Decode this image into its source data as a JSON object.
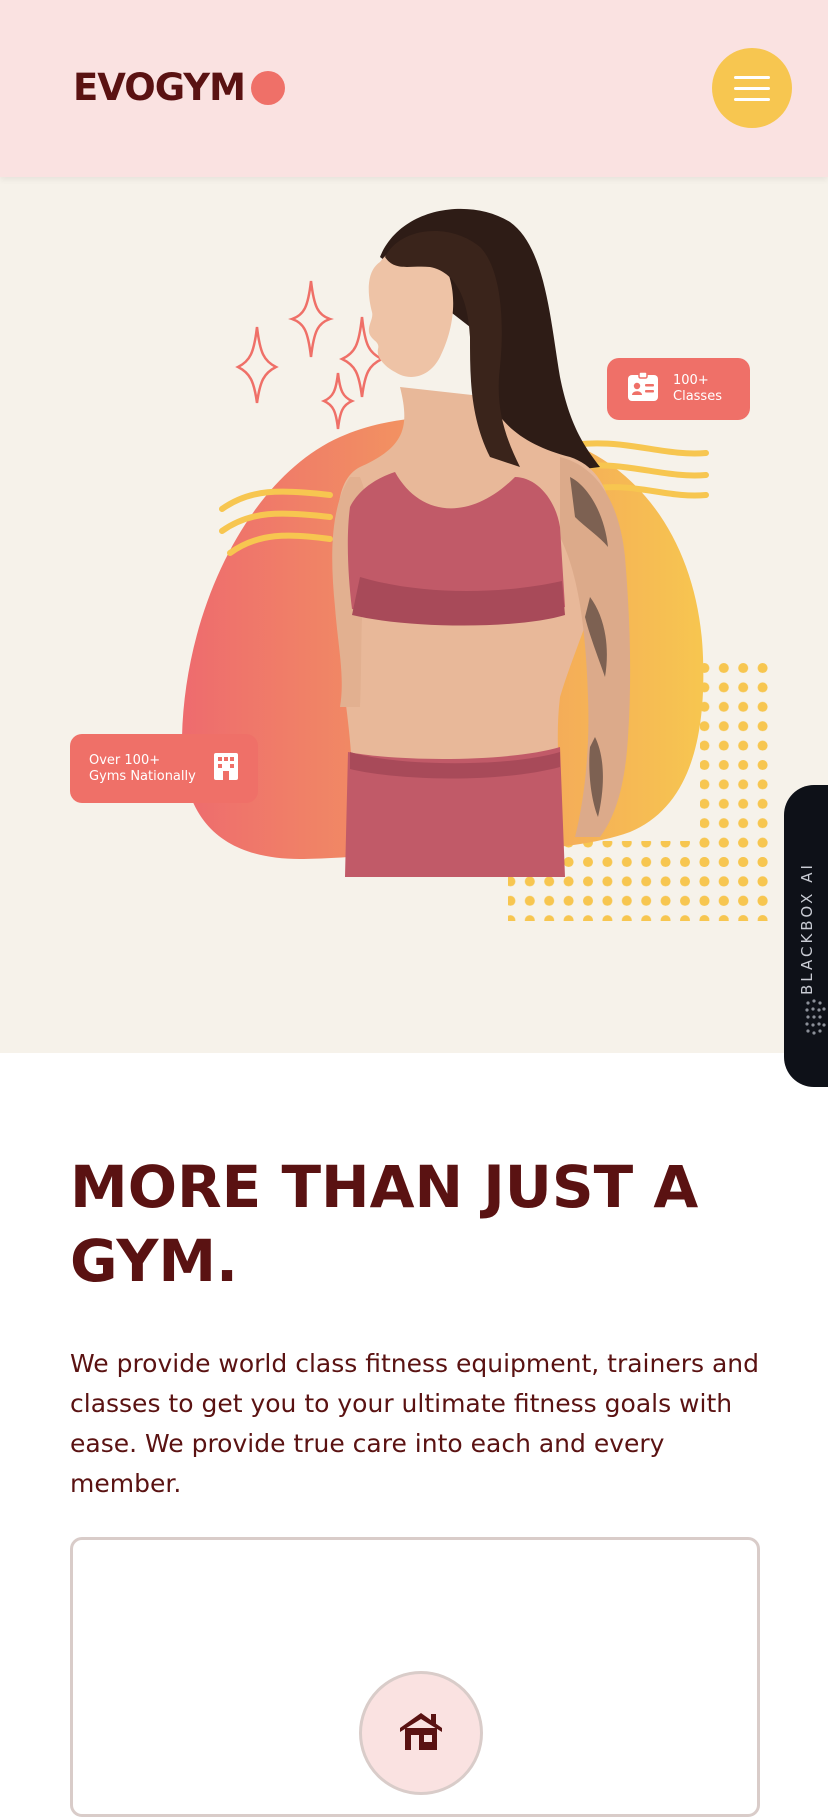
{
  "header": {
    "logo_text": "EVOGYM",
    "menu_icon": "hamburger-menu-icon"
  },
  "hero": {
    "badge_classes": {
      "line1": "100+",
      "line2": "Classes",
      "icon": "id-card-icon"
    },
    "badge_gyms": {
      "line1": "Over 100+",
      "line2": "Gyms Nationally",
      "icon": "building-icon"
    }
  },
  "side_tab": {
    "label": "BLACKBOX AI"
  },
  "main": {
    "title_line1": "MORE THAN JUST A",
    "title_line2": "GYM.",
    "description": "We provide world class fitness equipment, trainers and classes to get you to your ultimate fitness goals with ease. We provide true care into each and every member.",
    "card_icon": "home-icon"
  },
  "colors": {
    "header_bg": "#fae2e1",
    "primary_red": "#ef7068",
    "accent_yellow": "#f7c650",
    "text_dark": "#5a1212",
    "hero_bg": "#f6f2ea"
  }
}
